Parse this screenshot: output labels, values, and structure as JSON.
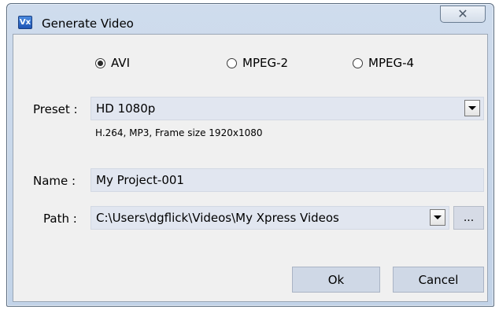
{
  "window": {
    "title": "Generate Video",
    "icon_text": "Vx",
    "close_glyph": "✕"
  },
  "format": {
    "options": [
      "AVI",
      "MPEG-2",
      "MPEG-4"
    ],
    "selected": "AVI"
  },
  "preset": {
    "label": "Preset :",
    "value": "HD 1080p",
    "description": "H.264, MP3, Frame size 1920x1080"
  },
  "name": {
    "label": "Name :",
    "value": "My Project-001"
  },
  "path": {
    "label": "Path :",
    "value": "C:\\Users\\dgflick\\Videos\\My Xpress Videos",
    "browse_label": "..."
  },
  "buttons": {
    "ok": "Ok",
    "cancel": "Cancel"
  }
}
